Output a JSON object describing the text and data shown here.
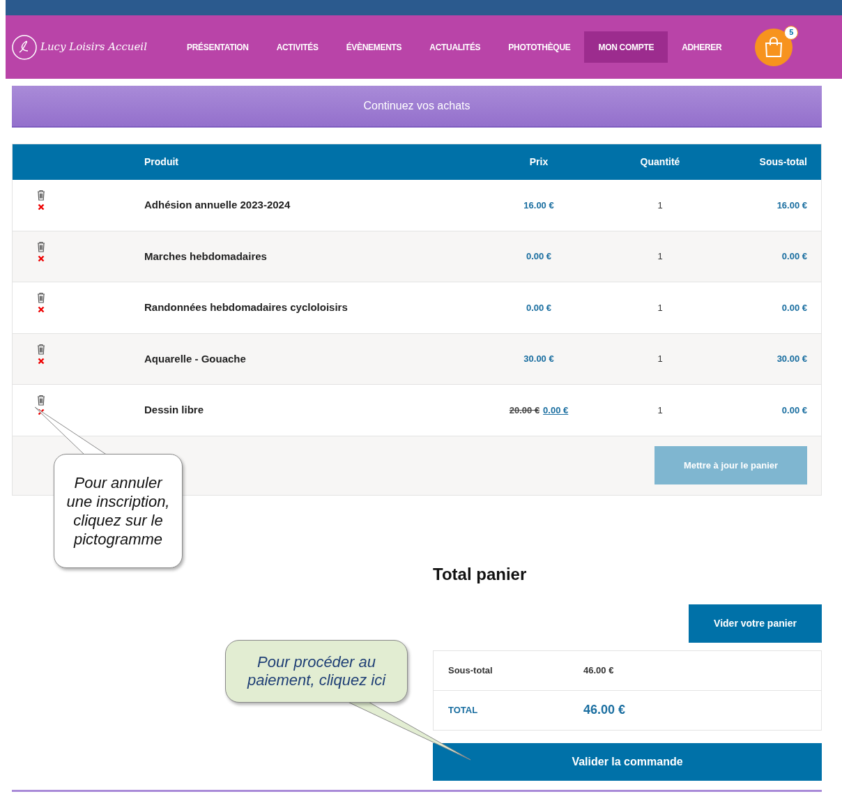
{
  "header": {
    "logo": "Lucy Loisirs Accueil",
    "nav": [
      {
        "label": "PRÉSENTATION",
        "selected": false
      },
      {
        "label": "ACTIVITÉS",
        "selected": false
      },
      {
        "label": "ÉVÈNEMENTS",
        "selected": false
      },
      {
        "label": "ACTUALITÉS",
        "selected": false
      },
      {
        "label": "PHOTOTHÈQUE",
        "selected": false
      },
      {
        "label": "MON COMPTE",
        "selected": true
      },
      {
        "label": "ADHERER",
        "selected": false
      }
    ],
    "cart_count": "5"
  },
  "continue_button": "Continuez vos achats",
  "cart_table": {
    "columns": [
      "Produit",
      "Prix",
      "Quantité",
      "Sous-total"
    ],
    "rows": [
      {
        "product": "Adhésion annuelle 2023-2024",
        "price": "16.00 €",
        "quantity": "1",
        "subtotal": "16.00 €"
      },
      {
        "product": "Marches hebdomadaires",
        "price": "0.00 €",
        "quantity": "1",
        "subtotal": "0.00 €"
      },
      {
        "product": "Randonnées hebdomadaires cycloloisirs",
        "price": "0.00 €",
        "quantity": "1",
        "subtotal": "0.00 €"
      },
      {
        "product": "Aquarelle - Gouache",
        "price": "30.00 €",
        "quantity": "1",
        "subtotal": "30.00 €"
      },
      {
        "product": "Dessin libre",
        "old_price": "20.00 €",
        "price": "0.00 €",
        "quantity": "1",
        "subtotal": "0.00 €"
      }
    ],
    "update_button": "Mettre à jour le panier"
  },
  "totals": {
    "title": "Total panier",
    "empty_button": "Vider votre panier",
    "subtotal_label": "Sous-total",
    "subtotal": "46.00 €",
    "total_label": "TOTAL",
    "total": "46.00 €",
    "checkout_button": "Valider la commande"
  },
  "callouts": [
    {
      "text": "Pour annuler une inscription, cliquez sur le pictogramme"
    },
    {
      "text": "Pour procéder au paiement, cliquez ici"
    }
  ]
}
